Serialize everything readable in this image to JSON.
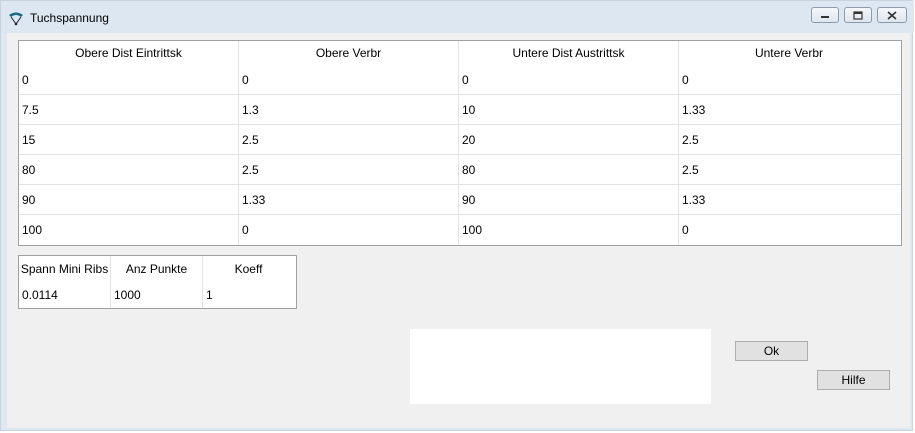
{
  "window": {
    "title": "Tuchspannung"
  },
  "main_table": {
    "headers": [
      "Obere Dist Eintrittsk",
      "Obere Verbr",
      "Untere Dist Austrittsk",
      "Untere Verbr"
    ],
    "rows": [
      [
        "0",
        "0",
        "0",
        "0"
      ],
      [
        "7.5",
        "1.3",
        "10",
        "1.33"
      ],
      [
        "15",
        "2.5",
        "20",
        "2.5"
      ],
      [
        "80",
        "2.5",
        "80",
        "2.5"
      ],
      [
        "90",
        "1.33",
        "90",
        "1.33"
      ],
      [
        "100",
        "0",
        "100",
        "0"
      ]
    ]
  },
  "params_table": {
    "headers": [
      "Spann Mini Ribs",
      "Anz Punkte",
      "Koeff"
    ],
    "rows": [
      [
        "0.0114",
        "1000",
        "1"
      ]
    ]
  },
  "buttons": {
    "ok": "Ok",
    "help": "Hilfe"
  },
  "icons": {
    "app": "paraglider-icon",
    "minimize": "minimize-icon",
    "maximize": "maximize-icon",
    "close": "close-icon"
  },
  "colors": {
    "titlebar": "#dde7f1",
    "client": "#f0f0f0",
    "button": "#e1e1e1"
  }
}
